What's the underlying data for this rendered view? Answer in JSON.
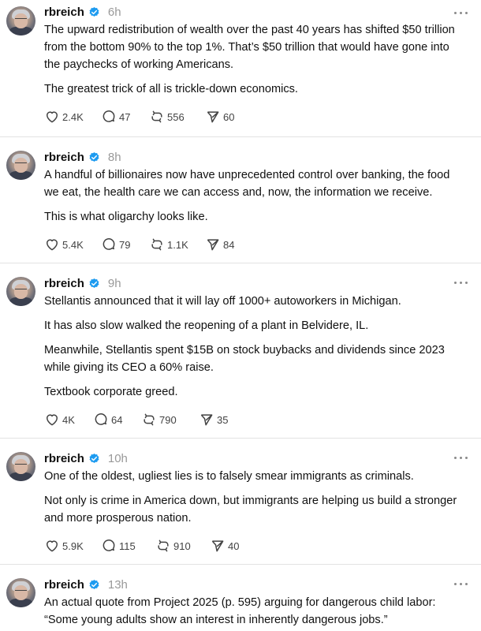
{
  "posts": [
    {
      "username": "rbreich",
      "time": "6h",
      "paragraphs": [
        "The upward redistribution of wealth over the past 40 years has shifted $50 trillion from the bottom 90% to the top 1%. That’s $50 trillion that would have gone into the paychecks of working Americans.",
        "The greatest trick of all is trickle-down economics."
      ],
      "likes": "2.4K",
      "replies": "47",
      "reposts": "556",
      "shares": "60"
    },
    {
      "username": "rbreich",
      "time": "8h",
      "paragraphs": [
        "A handful of billionaires now have unprecedented control over banking, the food we eat, the health care we can access and, now, the information we receive.",
        "This is what oligarchy looks like."
      ],
      "likes": "5.4K",
      "replies": "79",
      "reposts": "1.1K",
      "shares": "84"
    },
    {
      "username": "rbreich",
      "time": "9h",
      "paragraphs": [
        "Stellantis announced that it will lay off 1000+ autoworkers in Michigan.",
        "It has also slow walked the reopening of a plant in Belvidere, IL.",
        "Meanwhile, Stellantis spent $15B on stock buybacks and dividends since 2023 while giving its CEO a 60% raise.",
        "Textbook corporate greed."
      ],
      "likes": "4K",
      "replies": "64",
      "reposts": "790",
      "shares": "35"
    },
    {
      "username": "rbreich",
      "time": "10h",
      "paragraphs": [
        "One of the oldest, ugliest lies is to falsely smear immigrants as criminals.",
        "Not only is crime in America down, but immigrants are helping us build a stronger and more prosperous nation."
      ],
      "likes": "5.9K",
      "replies": "115",
      "reposts": "910",
      "shares": "40"
    },
    {
      "username": "rbreich",
      "time": "13h",
      "paragraphs": [
        "An actual quote from Project 2025 (p. 595) arguing for dangerous child labor: “Some young adults show an interest in inherently dangerous jobs.”"
      ]
    }
  ],
  "icons": {
    "verified": "verified-badge-icon",
    "more": "more-options-icon",
    "like": "heart-icon",
    "reply": "comment-bubble-icon",
    "repost": "repost-arrows-icon",
    "share": "send-paper-plane-icon"
  },
  "colors": {
    "verified": "#1d9bf0",
    "time": "#999999",
    "icon": "#424242"
  }
}
